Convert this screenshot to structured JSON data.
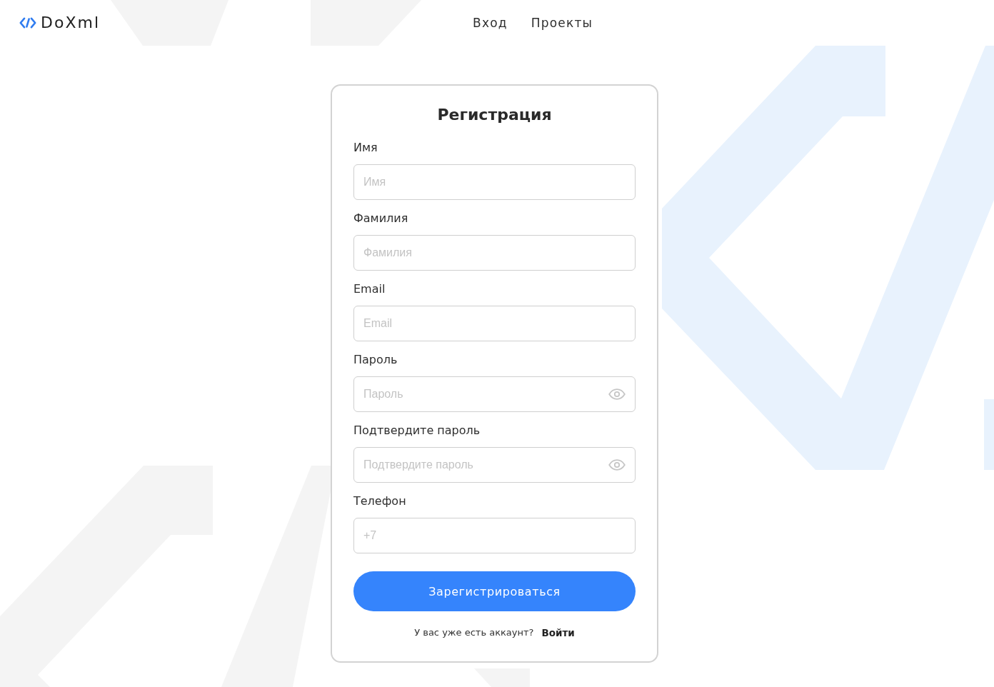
{
  "header": {
    "logo": "DoXml",
    "nav": [
      {
        "label": "Вход"
      },
      {
        "label": "Проекты"
      }
    ]
  },
  "form": {
    "title": "Регистрация",
    "fields": [
      {
        "kind": "text",
        "label": "Имя",
        "placeholder": "Имя"
      },
      {
        "kind": "text",
        "label": "Фамилия",
        "placeholder": "Фамилия"
      },
      {
        "kind": "email",
        "label": "Email",
        "placeholder": "Email"
      },
      {
        "kind": "password",
        "label": "Пароль",
        "placeholder": "Пароль"
      },
      {
        "kind": "password",
        "label": "Подтвердите пароль",
        "placeholder": "Подтвердите пароль"
      },
      {
        "kind": "phone",
        "label": "Телефон",
        "placeholder": "+7"
      }
    ],
    "submit": "Зарегистрироваться",
    "footer": {
      "text": "У вас уже есть аккаунт?",
      "link": "Войти"
    }
  }
}
